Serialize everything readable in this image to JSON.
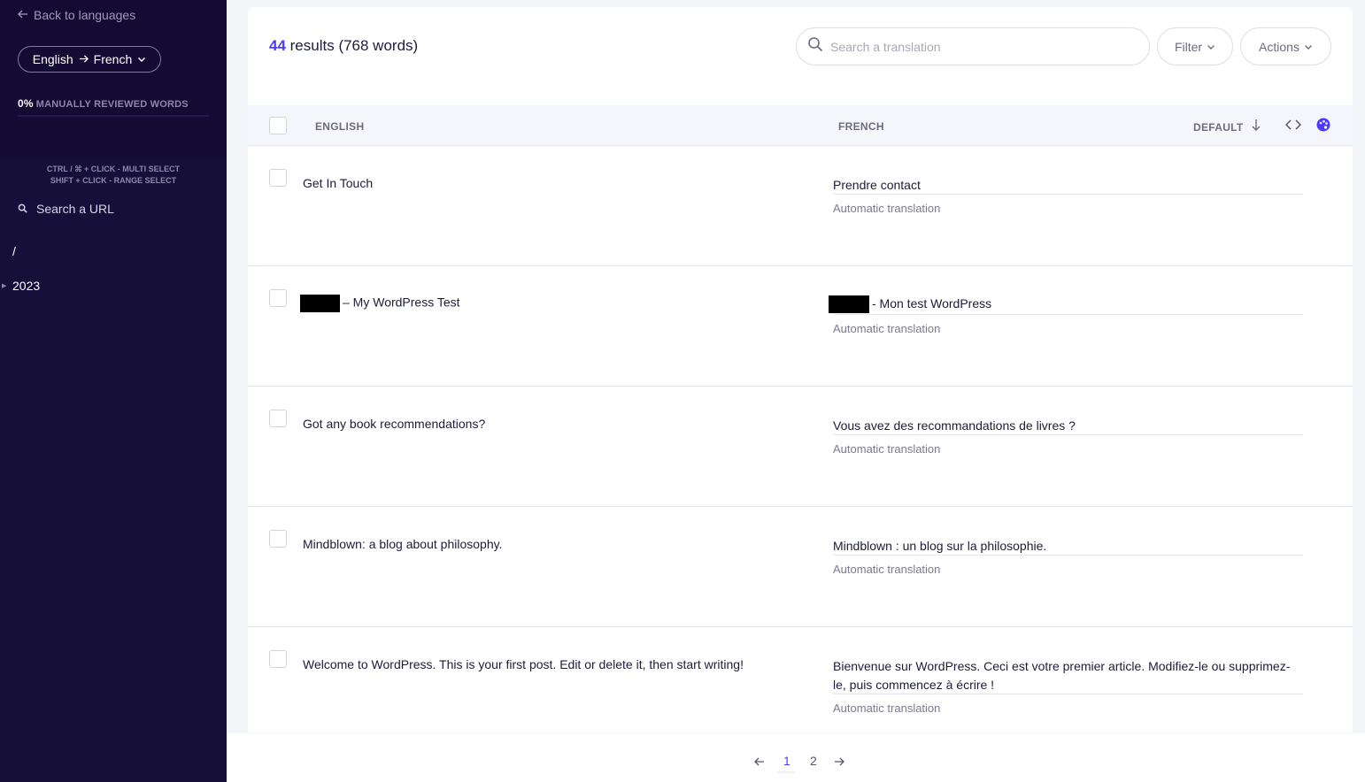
{
  "sidebar": {
    "back_label": "Back to languages",
    "source_language": "English",
    "target_language": "French",
    "progress_percent": "0%",
    "progress_label": "MANUALLY REVIEWED WORDS",
    "progress_value": 0,
    "hint_multi": "CTRL / ⌘ + CLICK - MULTI SELECT",
    "hint_range": "SHIFT + CLICK - RANGE SELECT",
    "url_search_label": "Search a URL",
    "tree": [
      "/",
      "2023"
    ]
  },
  "header": {
    "results_count": "44",
    "results_suffix": " results (768 words)",
    "search_placeholder": "Search a translation",
    "filter_label": "Filter",
    "actions_label": "Actions"
  },
  "table": {
    "col_source": "ENGLISH",
    "col_target": "FRENCH",
    "sort_label": "DEFAULT",
    "rows": [
      {
        "source": "Get In Touch",
        "target": "Prendre contact",
        "status": "Automatic translation"
      },
      {
        "source": "– My WordPress Test",
        "target": "- Mon test WordPress",
        "status": "Automatic translation"
      },
      {
        "source": "Got any book recommendations?",
        "target": "Vous avez des recommandations de livres ?",
        "status": "Automatic translation"
      },
      {
        "source": "Mindblown: a blog about philosophy.",
        "target": "Mindblown : un blog sur la philosophie.",
        "status": "Automatic translation"
      },
      {
        "source": "Welcome to WordPress. This is your first post. Edit or delete it, then start writing!",
        "target": "Bienvenue sur WordPress. Ceci est votre premier article. Modifiez-le ou supprimez-le, puis commencez à écrire !",
        "status": "Automatic translation"
      }
    ]
  },
  "pagination": {
    "pages": [
      "1",
      "2"
    ],
    "current": "1"
  },
  "colors": {
    "accent": "#4b3bff",
    "sidebar_bg": "#150f3a"
  }
}
